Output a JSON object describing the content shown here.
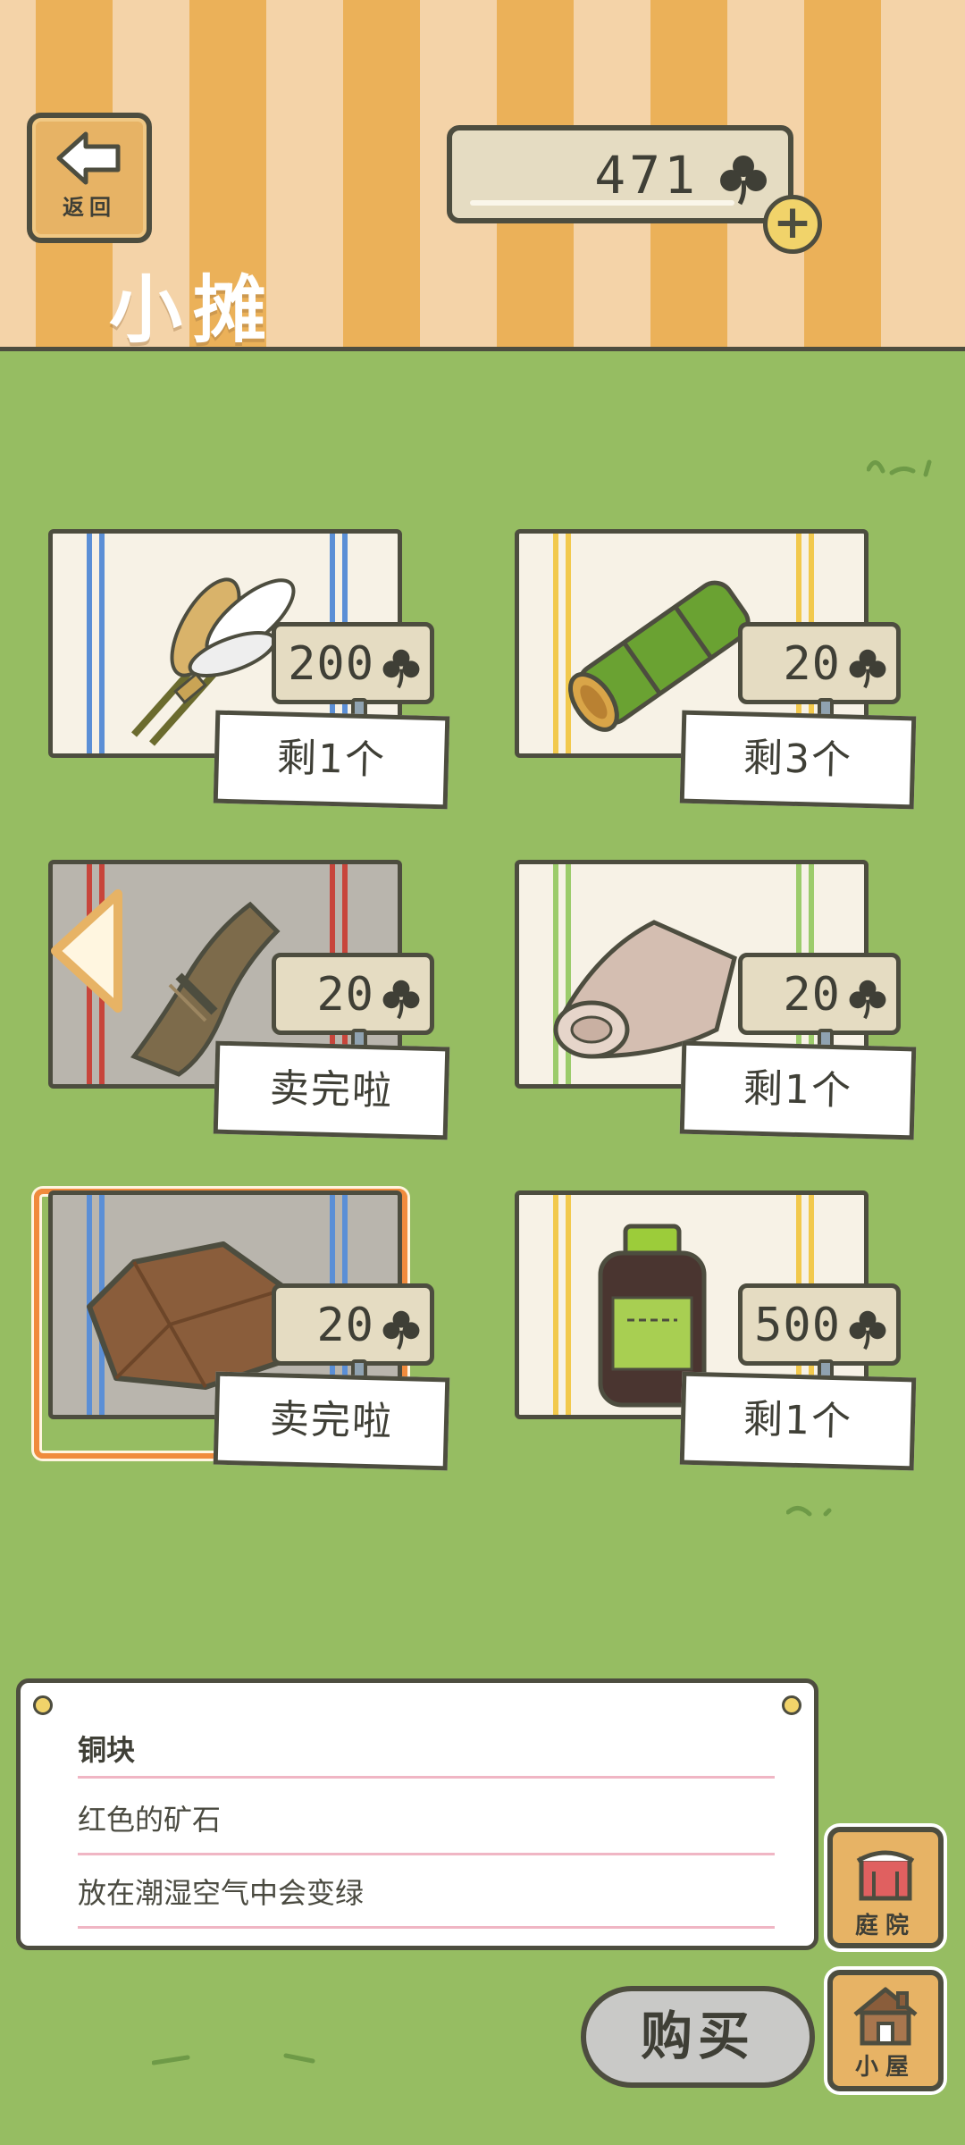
{
  "header": {
    "back_label": "返回",
    "title": "小摊",
    "coins": "471",
    "add_label": "+"
  },
  "items": [
    {
      "name": "feather-bundle",
      "price": "200",
      "stock": "剩1个",
      "cloth_color": "#f7f2e6",
      "stripe_color": "#5b8fd6"
    },
    {
      "name": "bamboo",
      "price": "20",
      "stock": "剩3个",
      "cloth_color": "#f7f2e6",
      "stripe_color": "#f2c94c"
    },
    {
      "name": "bark-rope",
      "price": "20",
      "stock": "卖完啦",
      "cloth_color": "#b9b5ad",
      "stripe_color": "#c8453b"
    },
    {
      "name": "cloth-roll",
      "price": "20",
      "stock": "剩1个",
      "cloth_color": "#f7f2e6",
      "stripe_color": "#9ccc6b"
    },
    {
      "name": "copper-ore",
      "price": "20",
      "stock": "卖完啦",
      "cloth_color": "#b9b5ad",
      "stripe_color": "#5b8fd6"
    },
    {
      "name": "medicine-bottle",
      "price": "500",
      "stock": "剩1个",
      "cloth_color": "#f7f2e6",
      "stripe_color": "#f2c94c"
    }
  ],
  "description": {
    "title": "铜块",
    "line1": "红色的矿石",
    "line2": "放在潮湿空气中会变绿"
  },
  "buttons": {
    "yard": "庭院",
    "house": "小屋",
    "buy": "购买"
  },
  "colors": {
    "grass": "#96bd62",
    "selected_border": "#f08b3d",
    "wood": "#e7b365"
  }
}
